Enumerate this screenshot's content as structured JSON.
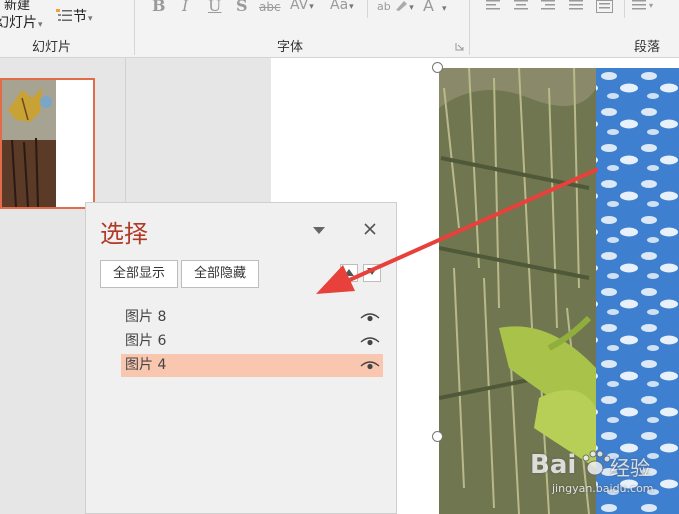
{
  "ribbon": {
    "new_slide_label_top": "新建",
    "new_slide_label_bottom": "幻灯片",
    "section_label": "节",
    "bold": "B",
    "italic": "I",
    "underline": "U",
    "shadow": "S",
    "strikethrough": "abc",
    "char_spacing": "AV",
    "change_case": "Aa",
    "highlight_text": "ab",
    "font_color": "A",
    "group_slides": "幻灯片",
    "group_font": "字体",
    "group_paragraph": "段落"
  },
  "selection_pane": {
    "title": "选择",
    "show_all": "全部显示",
    "hide_all": "全部隐藏",
    "items": [
      {
        "label": "图片 8",
        "selected": false
      },
      {
        "label": "图片 6",
        "selected": false
      },
      {
        "label": "图片 4",
        "selected": true
      }
    ]
  },
  "watermark": {
    "brand": "Bai",
    "brand2": "经验",
    "url": "jingyan.baidu.com"
  },
  "colors": {
    "accent": "#b13a27",
    "selected_row": "#f9c7b0",
    "thumbnail_border": "#e26b4a",
    "arrow": "#e8403a"
  }
}
